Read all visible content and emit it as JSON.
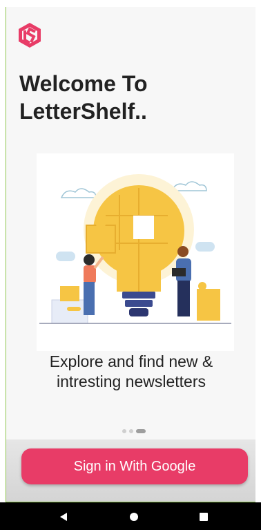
{
  "app": {
    "brand_color": "#e83c67",
    "logo_icon": "lettershelf-logo-icon"
  },
  "welcome": {
    "title_line1": "Welcome To",
    "title_line2": "LetterShelf.."
  },
  "onboarding": {
    "illustration": "lightbulb-puzzle-illustration",
    "subtitle_line1": "Explore and find new &",
    "subtitle_line2": "intresting newsletters",
    "pages": 3,
    "current_page": 3
  },
  "actions": {
    "google_signin_label": "Sign in With Google"
  },
  "system_nav": {
    "back_icon": "back-triangle-icon",
    "home_icon": "home-circle-icon",
    "recents_icon": "recents-square-icon"
  }
}
